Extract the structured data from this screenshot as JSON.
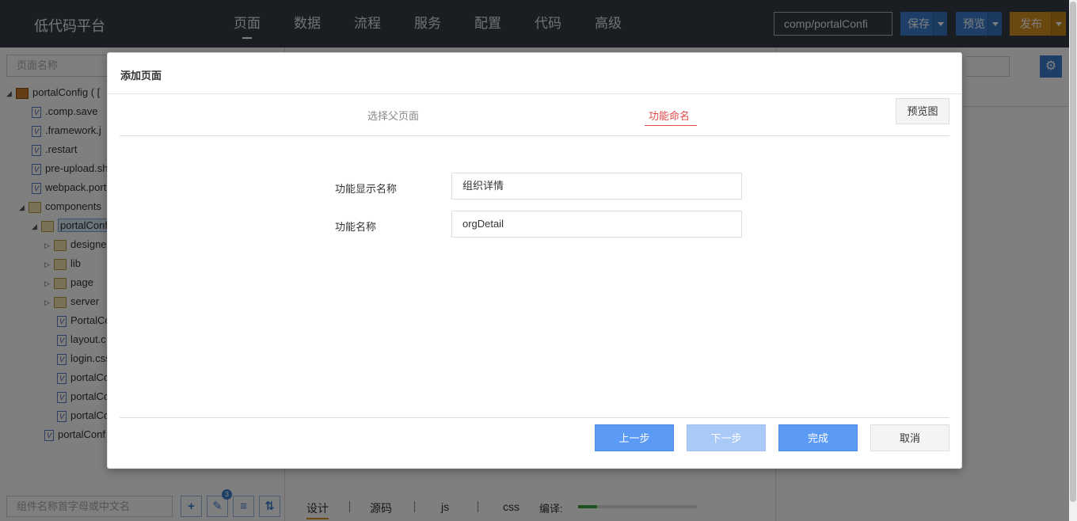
{
  "app": {
    "title": "低代码平台"
  },
  "nav": [
    "页面",
    "数据",
    "流程",
    "服务",
    "配置",
    "代码",
    "高级"
  ],
  "header": {
    "path": "comp/portalConfi",
    "save_label": "保存",
    "preview_label": "预览",
    "publish_label": "发布"
  },
  "left": {
    "search_placeholder": "页面名称",
    "tree": [
      {
        "label": "portalConfig ( [",
        "icon": "project"
      },
      {
        "label": ".comp.save",
        "icon": "file"
      },
      {
        "label": ".framework.j",
        "icon": "file"
      },
      {
        "label": ".restart",
        "icon": "file"
      },
      {
        "label": "pre-upload.sh",
        "icon": "file"
      },
      {
        "label": "webpack.port",
        "icon": "file"
      },
      {
        "label": "components",
        "icon": "folder"
      },
      {
        "label": "portalConf",
        "icon": "folder"
      },
      {
        "label": "designe",
        "icon": "folder"
      },
      {
        "label": "lib",
        "icon": "folder"
      },
      {
        "label": "page",
        "icon": "folder"
      },
      {
        "label": "server",
        "icon": "folder"
      },
      {
        "label": "PortalCo",
        "icon": "file"
      },
      {
        "label": "layout.c",
        "icon": "file"
      },
      {
        "label": "login.css",
        "icon": "file"
      },
      {
        "label": "portalCo",
        "icon": "file"
      },
      {
        "label": "portalCo",
        "icon": "file"
      },
      {
        "label": "portalCo",
        "icon": "file"
      },
      {
        "label": "portalConf",
        "icon": "file"
      }
    ],
    "component_search_placeholder": "组件名称首字母或中文名",
    "badge_count": "3"
  },
  "center": {
    "tabs": [
      "设计",
      "源码",
      "js",
      "css"
    ],
    "compile_label": "编译:",
    "compile_progress": 0.16
  },
  "modal": {
    "title": "添加页面",
    "steps": [
      "选择父页面",
      "功能命名"
    ],
    "active_step": 1,
    "preview_button": "预览图",
    "fields": [
      {
        "label": "功能显示名称",
        "value": "组织详情"
      },
      {
        "label": "功能名称",
        "value": "orgDetail"
      }
    ],
    "buttons": {
      "prev": "上一步",
      "next": "下一步",
      "finish": "完成",
      "cancel": "取消"
    }
  },
  "colors": {
    "topbar": "#353c47",
    "primary": "#3b7fcf",
    "publish": "#d4911f",
    "active_step": "#e34a4a",
    "modal_button": "#5b9bf5"
  }
}
